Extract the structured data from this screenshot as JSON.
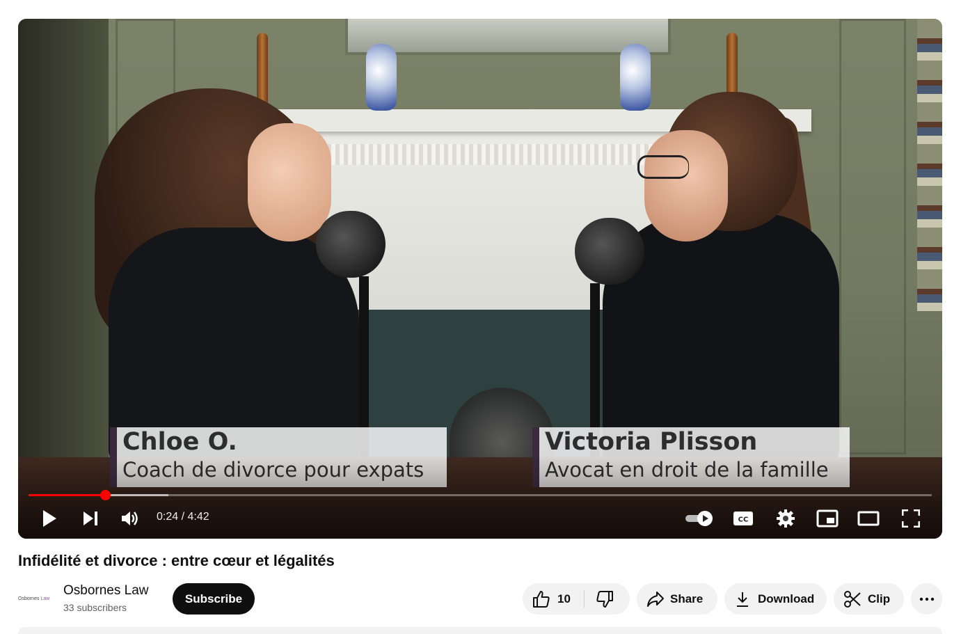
{
  "video": {
    "lower_thirds": [
      {
        "name": "Chloe O.",
        "role": "Coach de divorce pour expats"
      },
      {
        "name": "Victoria Plisson",
        "role": "Avocat en droit de la famille"
      }
    ],
    "progress_fraction": 0.0851,
    "buffered_fraction": 0.155,
    "time_display": "0:24 / 4:42",
    "controls": {
      "play": "play-icon",
      "next": "next-icon",
      "volume": "volume-icon",
      "autoplay": "autoplay-toggle",
      "captions": "cc-icon",
      "settings": "gear-icon",
      "miniplayer": "miniplayer-icon",
      "theater": "theater-icon",
      "fullscreen": "fullscreen-icon"
    }
  },
  "title": "Infidélité et divorce : entre cœur et légalités",
  "channel": {
    "logo_text": "Osbornes",
    "logo_accent": "Law",
    "name": "Osbornes Law",
    "subscribers": "33 subscribers",
    "subscribe_label": "Subscribe"
  },
  "actions": {
    "like_count": "10",
    "share_label": "Share",
    "download_label": "Download",
    "clip_label": "Clip"
  },
  "colors": {
    "accent_red": "#ff0000",
    "button_dark": "#0f0f0f",
    "pill_bg": "#f2f2f2"
  }
}
